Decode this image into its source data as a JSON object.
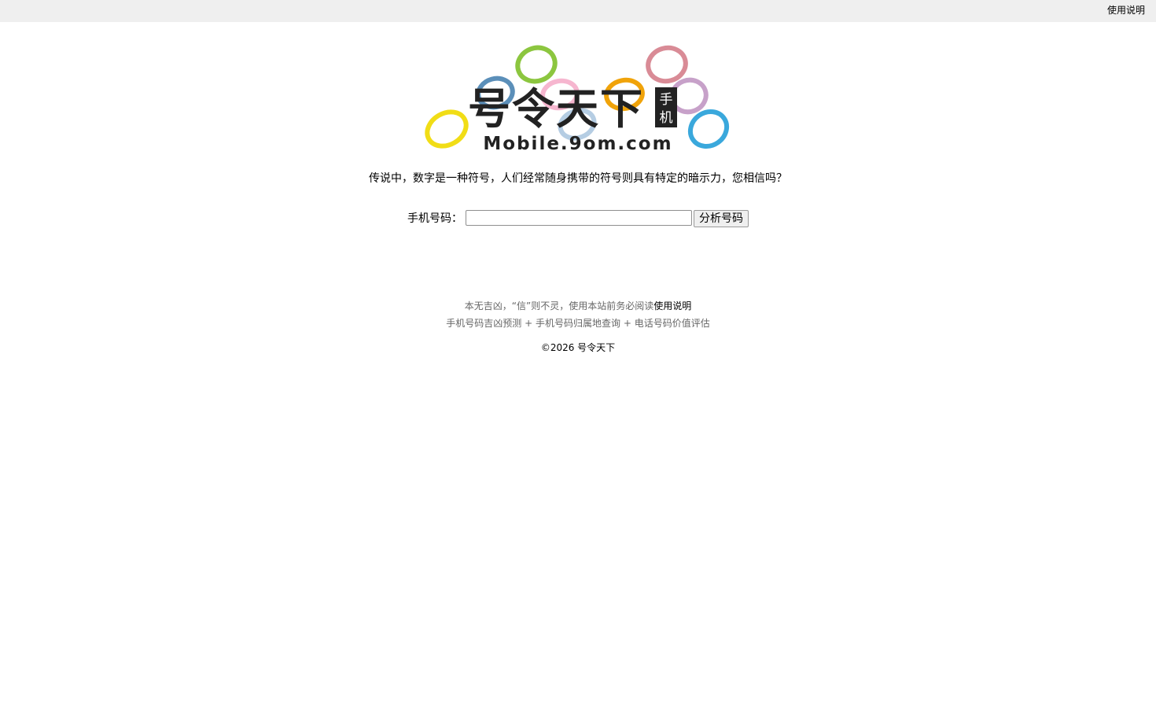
{
  "topbar": {
    "help_link": "使用说明"
  },
  "logo": {
    "title_chars": "号令天下",
    "badge_top": "手",
    "badge_bottom": "机",
    "domain": "Mobile.9om.com",
    "ring_colors": [
      "#8cc63f",
      "#5b8fb9",
      "#f6b6cf",
      "#f0a30a",
      "#d98b96",
      "#c7a1c9",
      "#f1dd16",
      "#3aa8dc",
      "#b5cde3"
    ]
  },
  "tagline": "传说中，数字是一种符号，人们经常随身携带的符号则具有特定的暗示力，您相信吗？",
  "form": {
    "label": "手机号码：",
    "input_value": "",
    "submit_label": "分析号码"
  },
  "footer": {
    "notice_text": "本无吉凶，“信”则不灵，使用本站前务必阅读",
    "notice_link": "使用说明",
    "links": [
      "手机号码吉凶预测",
      "手机号码归属地查询",
      "电话号码价值评估"
    ],
    "separator": " + ",
    "copyright": "©2026 号令天下"
  }
}
